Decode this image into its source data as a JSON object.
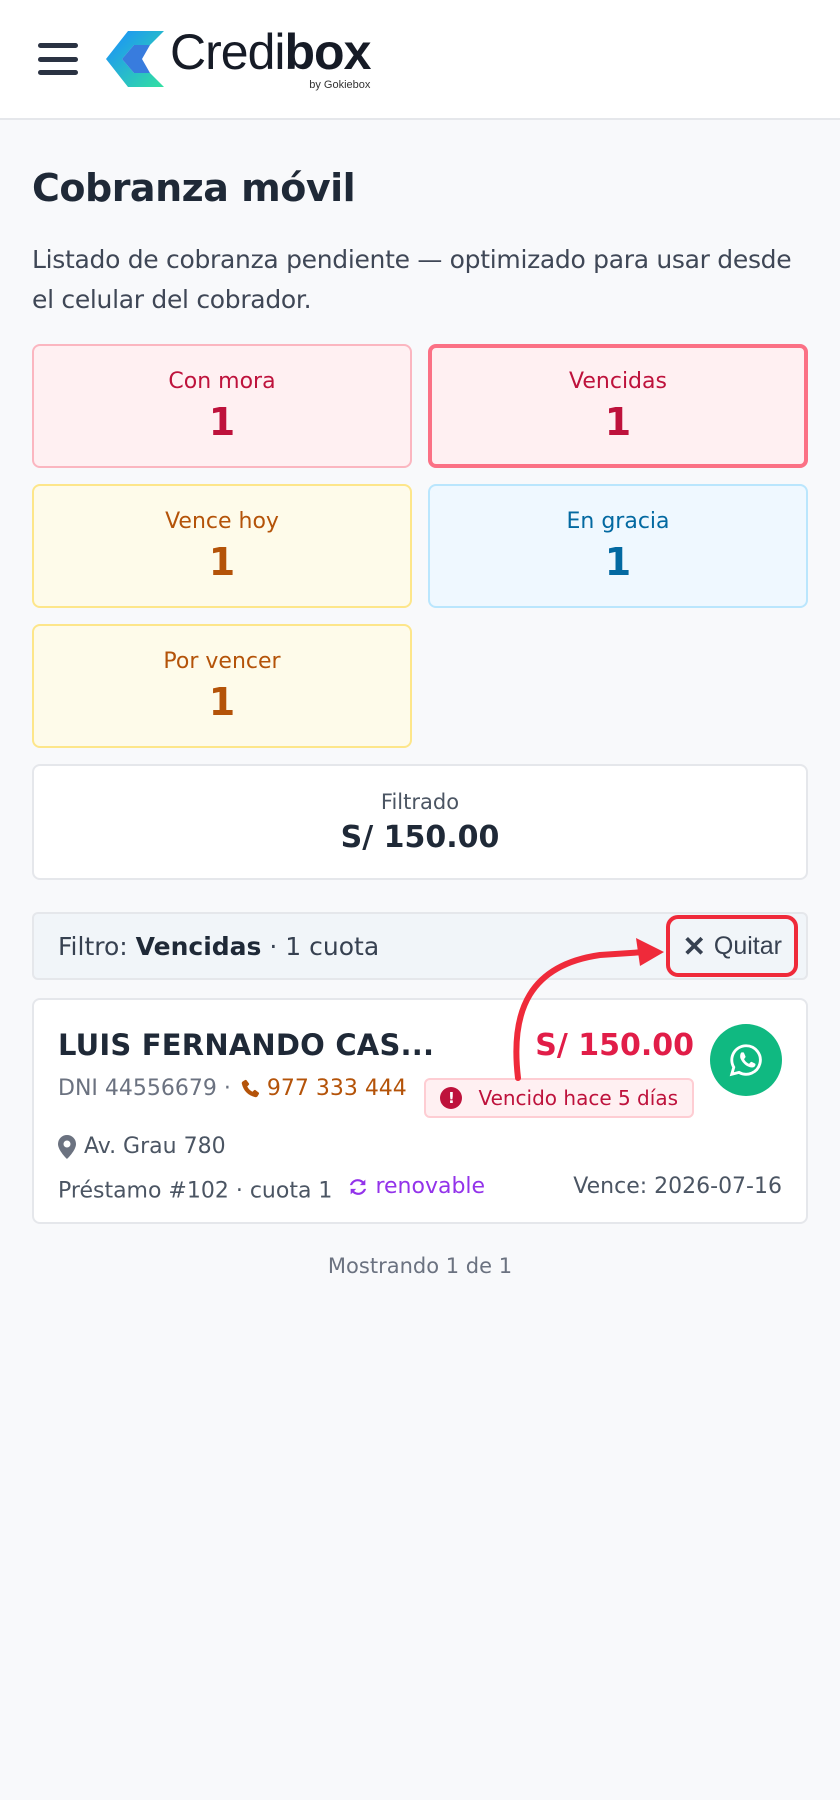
{
  "header": {
    "brand_light": "Credi",
    "brand_bold": "box",
    "brand_sub": "by Gokiebox",
    "colors": {
      "logo_blue": "#1a8cff",
      "logo_green": "#33e0a1"
    }
  },
  "page": {
    "title": "Cobranza móvil",
    "description": "Listado de cobranza pendiente — optimizado para usar desde el celular del cobrador."
  },
  "stats": [
    {
      "label": "Con mora",
      "value": "1",
      "tone": "red"
    },
    {
      "label": "Vencidas",
      "value": "1",
      "tone": "red",
      "active": true
    },
    {
      "label": "Vence hoy",
      "value": "1",
      "tone": "yellow"
    },
    {
      "label": "En gracia",
      "value": "1",
      "tone": "blue"
    },
    {
      "label": "Por vencer",
      "value": "1",
      "tone": "yellow"
    }
  ],
  "filtered": {
    "label": "Filtrado",
    "value": "S/ 150.00"
  },
  "filter_bar": {
    "prefix": "Filtro:",
    "filter_name": "Vencidas",
    "suffix": "· 1 cuota",
    "clear_label": "Quitar"
  },
  "card": {
    "name": "LUIS FERNANDO CAS...",
    "amount": "S/ 150.00",
    "dni": "DNI 44556679 ·",
    "phone": "977 333 444",
    "badge": "Vencido hace 5 días",
    "address": "Av. Grau 780",
    "loan": "Préstamo #102 · cuota 1",
    "renewable": "renovable",
    "due": "Vence: 2026-07-16",
    "icons": [
      "whatsapp-icon",
      "phone-icon",
      "alert-icon",
      "map-pin-icon",
      "refresh-icon"
    ]
  },
  "footer": {
    "count": "Mostrando 1 de 1"
  },
  "colors": {
    "accent_red": "#e11d48",
    "annotation_red": "#ef2a3a",
    "whatsapp_green": "#10b981"
  }
}
